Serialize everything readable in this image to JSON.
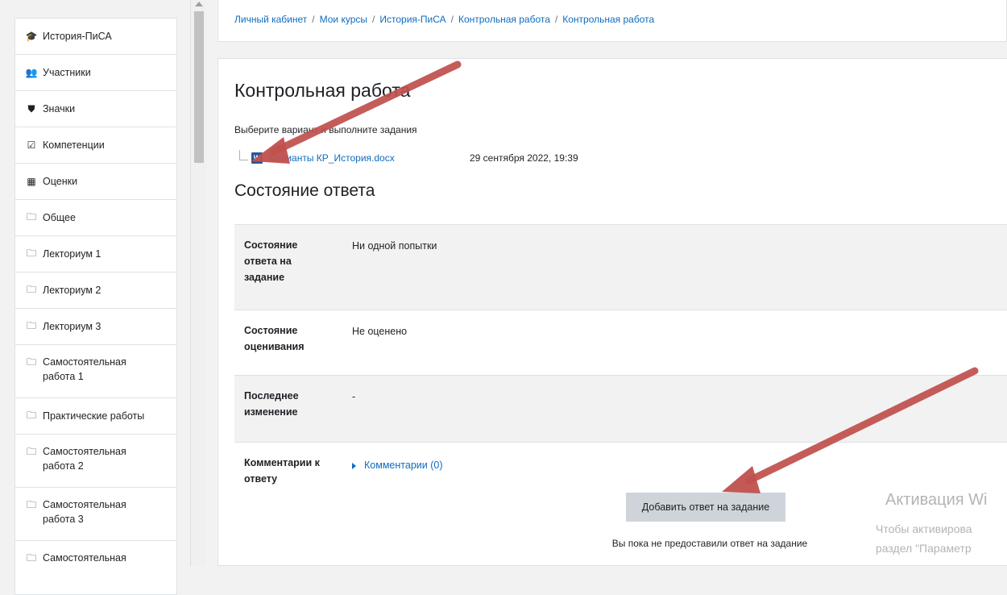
{
  "sidebar": {
    "items": [
      {
        "label": "История-ПиСА",
        "icon": "graduation-cap-icon"
      },
      {
        "label": "Участники",
        "icon": "users-icon"
      },
      {
        "label": "Значки",
        "icon": "shield-icon"
      },
      {
        "label": "Компетенции",
        "icon": "checkbox-icon"
      },
      {
        "label": "Оценки",
        "icon": "table-icon"
      },
      {
        "label": "Общее",
        "icon": "folder-icon"
      },
      {
        "label": "Лекториум 1",
        "icon": "folder-icon"
      },
      {
        "label": "Лекториум 2",
        "icon": "folder-icon"
      },
      {
        "label": "Лекториум 3",
        "icon": "folder-icon"
      },
      {
        "label": "Самостоятельная работа 1",
        "icon": "folder-icon"
      },
      {
        "label": "Практические работы",
        "icon": "folder-icon"
      },
      {
        "label": "Самостоятельная работа 2",
        "icon": "folder-icon"
      },
      {
        "label": "Самостоятельная работа 3",
        "icon": "folder-icon"
      },
      {
        "label": "Самостоятельная",
        "icon": "folder-icon"
      }
    ]
  },
  "breadcrumb": [
    "Личный кабинет",
    "Мои курсы",
    "История-ПиСА",
    "Контрольная работа",
    "Контрольная работа"
  ],
  "page": {
    "title": "Контрольная работа",
    "intro": "Выберите вариант и выполните задания",
    "file": {
      "name": "Варианты КР_История.docx",
      "date": "29 сентября 2022, 19:39",
      "icon": "word-document-icon"
    },
    "section_title": "Состояние ответа"
  },
  "status_table": [
    {
      "label": "Состояние ответа на задание",
      "value": "Ни одной попытки"
    },
    {
      "label": "Состояние оценивания",
      "value": "Не оценено"
    },
    {
      "label": "Последнее изменение",
      "value": "-"
    },
    {
      "label": "Комментарии к ответу",
      "value": "Комментарии (0)"
    }
  ],
  "actions": {
    "add_submission": "Добавить ответ на задание",
    "no_submission_text": "Вы пока не предоставили ответ на задание"
  },
  "watermark": {
    "title": "Активация Wi",
    "line1": "Чтобы активирова",
    "line2": "раздел \"Параметр"
  },
  "colors": {
    "link": "#0f6cbf",
    "arrow": "#c0504d",
    "button": "#ced4da",
    "row_alt": "#f2f2f2"
  }
}
